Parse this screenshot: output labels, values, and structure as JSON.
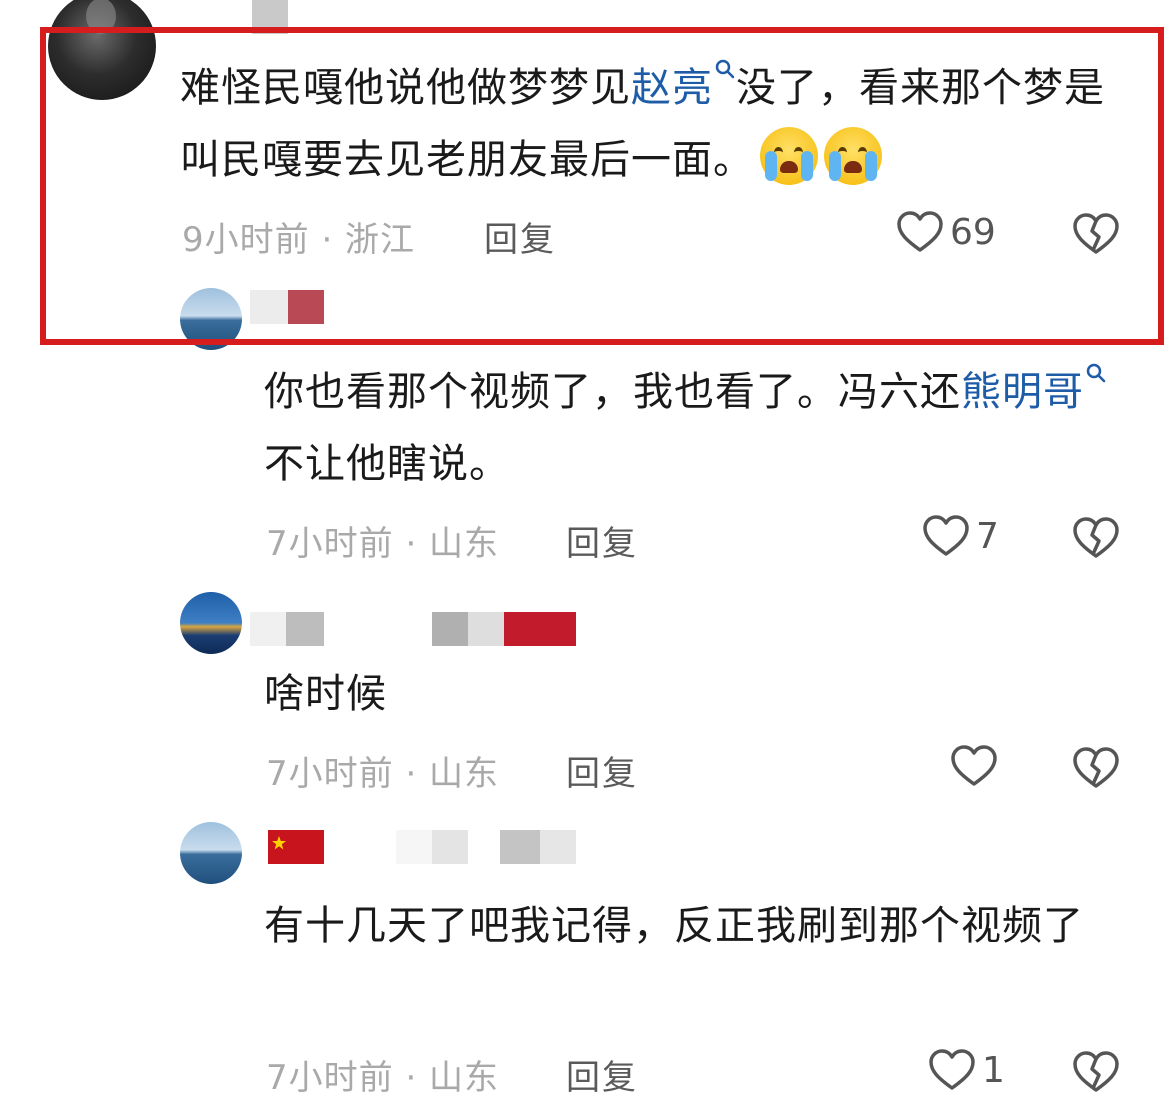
{
  "comments": [
    {
      "text_parts": [
        "难怪民嘎他说他做梦梦见",
        "赵亮",
        "没了，看来那个梦是叫民嘎要去见老朋友最后一面。"
      ],
      "emoji": [
        "loudly-crying-face-emoji",
        "loudly-crying-face-emoji"
      ],
      "time_location": "9小时前 · 浙江",
      "reply_label": "回复",
      "like_count": "69",
      "highlighted": true
    },
    {
      "text_parts": [
        "你也看那个视频了，我也看了。冯六还",
        "熊明哥",
        "不让他瞎说。"
      ],
      "time_location": "7小时前 · 山东",
      "reply_label": "回复",
      "like_count": "7"
    },
    {
      "text": "啥时候",
      "time_location": "7小时前 · 山东",
      "reply_label": "回复",
      "like_count": ""
    },
    {
      "text": "有十几天了吧我记得，反正我刷到那个视频了",
      "time_location": "7小时前 · 山东",
      "reply_label": "回复",
      "like_count": "1"
    }
  ],
  "colors": {
    "link": "#1f5ca8",
    "highlight_border": "#d61c1c",
    "meta": "#a9a9a9"
  },
  "icons": [
    "heart-outline-icon",
    "broken-heart-icon",
    "search-mini-icon"
  ]
}
